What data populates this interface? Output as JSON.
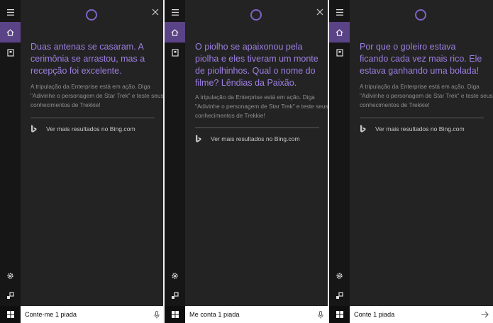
{
  "colors": {
    "accent": "#5a4386",
    "joke_text": "#9d7fe2",
    "cortana_ring": "#7e64c6"
  },
  "panels": [
    {
      "joke": "Duas antenas se casaram. A cerimônia se arrastou, mas a recepção foi excelente.",
      "subtitle": "A tripulação da Enterprise está em ação. Diga \"Adivinhe o personagem de Star Trek\" e teste seus conhecimentos de Trekkie!",
      "bing_link": "Ver mais resultados no Bing.com",
      "query": "Conte-me 1 piada",
      "trailing_icon": "microphone-icon",
      "has_close": true
    },
    {
      "joke": "O piolho se apaixonou pela piolha e eles tiveram um monte de piolhinhos. Qual o nome do filme? Lêndias da Paixão.",
      "subtitle": "A tripulação da Enterprise está em ação. Diga \"Adivinhe o personagem de Star Trek\" e teste seus conhecimentos de Trekkie!",
      "bing_link": "Ver mais resultados no Bing.com",
      "query": "Me conta 1 piada",
      "trailing_icon": "microphone-icon",
      "has_close": true
    },
    {
      "joke": "Por que o goleiro estava ficando cada vez mais rico. Ele estava ganhando uma bolada!",
      "subtitle": "A tripulação da Enterprise está em ação. Diga \"Adivinhe o personagem de Star Trek\" e teste seus conhecimentos de Trekkie!",
      "bing_link": "Ver mais resultados no Bing.com",
      "query": "Conte 1 piada",
      "trailing_icon": "arrow-right-icon",
      "has_close": false
    }
  ],
  "sidebar_icons": [
    "hamburger-menu-icon",
    "home-icon",
    "notebook-icon",
    "settings-gear-icon",
    "feedback-icon"
  ],
  "taskbar_icon": "windows-start-icon"
}
